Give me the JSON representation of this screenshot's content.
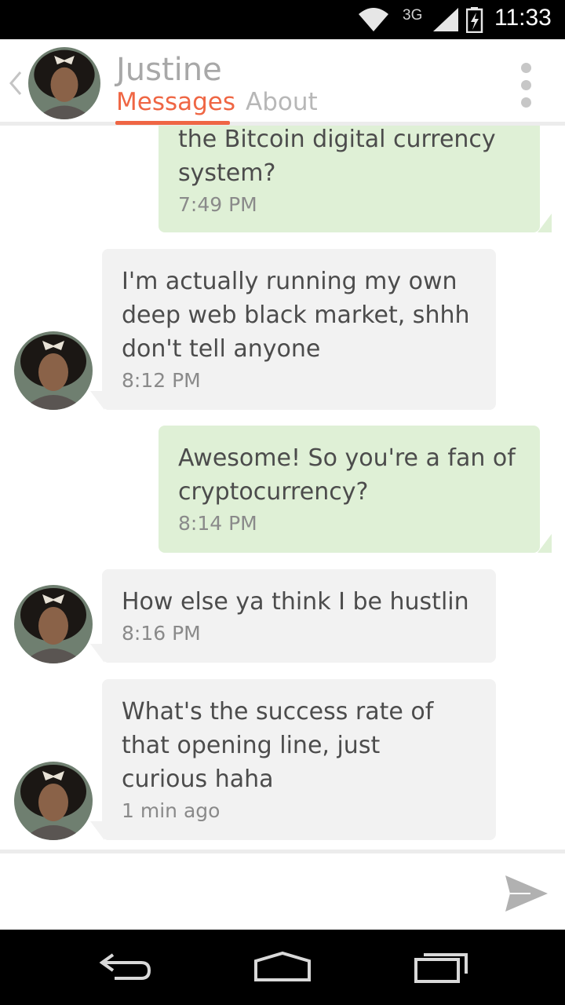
{
  "status_bar": {
    "network": "3G",
    "time": "11:33",
    "icons": [
      "wifi-icon",
      "signal-icon",
      "battery-charging-icon"
    ]
  },
  "header": {
    "name": "Justine",
    "tabs": [
      {
        "label": "Messages",
        "active": true
      },
      {
        "label": "About",
        "active": false
      }
    ],
    "accent_color": "#ef6644"
  },
  "messages": [
    {
      "direction": "outgoing",
      "text": "the Bitcoin digital currency\nsystem?",
      "time": "7:49 PM"
    },
    {
      "direction": "incoming",
      "text": "I'm actually running my own\ndeep web black market, shhh\ndon't tell anyone",
      "time": "8:12 PM"
    },
    {
      "direction": "outgoing",
      "text": "Awesome! So you're a fan of\ncryptocurrency?",
      "time": "8:14 PM"
    },
    {
      "direction": "incoming",
      "text": "How else ya think I be hustlin",
      "time": "8:16 PM"
    },
    {
      "direction": "incoming",
      "text": "What's the success rate of\nthat opening line, just\ncurious haha",
      "time": "1 min ago"
    }
  ],
  "colors": {
    "outgoing_bubble": "#dff0d6",
    "incoming_bubble": "#f2f2f2"
  },
  "compose": {
    "placeholder": "",
    "send_icon": "send-icon"
  },
  "nav_bar": {
    "icons": [
      "back-icon",
      "home-icon",
      "recents-icon"
    ]
  }
}
